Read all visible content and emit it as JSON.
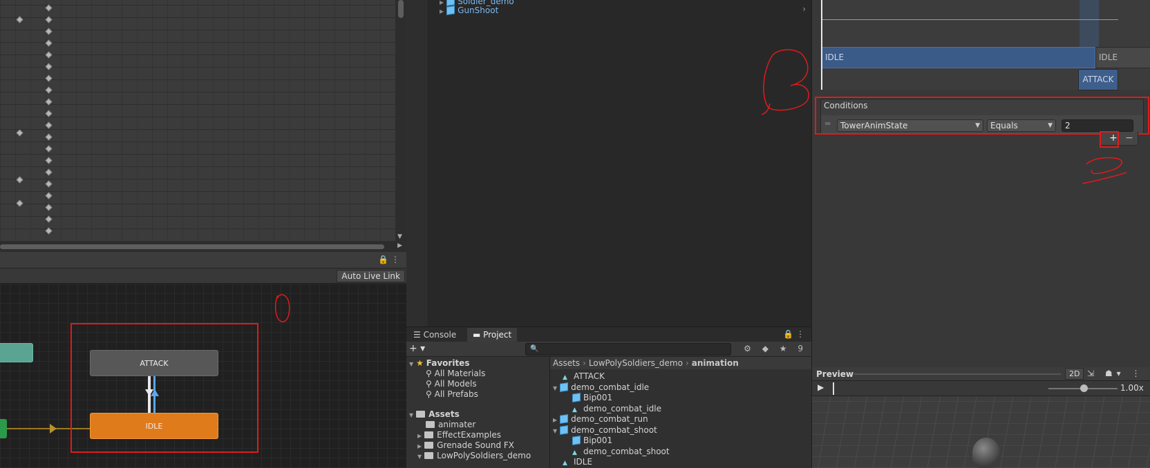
{
  "animator": {
    "auto_live_link": "Auto Live Link",
    "states": {
      "attack": "ATTACK",
      "idle": "IDLE"
    }
  },
  "hierarchy": {
    "items": [
      "Soldier_demo",
      "GunShoot"
    ]
  },
  "project": {
    "tabs": [
      "Console",
      "Project"
    ],
    "hidden_count": "9",
    "tree": {
      "favorites_label": "Favorites",
      "favorites": [
        "All Materials",
        "All Models",
        "All Prefabs"
      ],
      "assets_label": "Assets",
      "assets": [
        "animater",
        "EffectExamples",
        "Grenade Sound FX",
        "LowPolySoldiers_demo"
      ]
    },
    "breadcrumb": [
      "Assets",
      "LowPolySoldiers_demo",
      "animation"
    ],
    "files": [
      {
        "name": "ATTACK",
        "kind": "clip",
        "indent": 0
      },
      {
        "name": "demo_combat_idle",
        "kind": "model",
        "indent": 0,
        "expanded": true
      },
      {
        "name": "Bip001",
        "kind": "model",
        "indent": 1
      },
      {
        "name": "demo_combat_idle",
        "kind": "clip",
        "indent": 1
      },
      {
        "name": "demo_combat_run",
        "kind": "model",
        "indent": 0,
        "expanded": false
      },
      {
        "name": "demo_combat_shoot",
        "kind": "model",
        "indent": 0,
        "expanded": true
      },
      {
        "name": "Bip001",
        "kind": "model",
        "indent": 1
      },
      {
        "name": "demo_combat_shoot",
        "kind": "clip",
        "indent": 1
      },
      {
        "name": "IDLE",
        "kind": "clip",
        "indent": 0
      }
    ]
  },
  "inspector": {
    "timeline": {
      "idle_main": "IDLE",
      "idle_side": "IDLE",
      "attack": "ATTACK"
    },
    "conditions": {
      "title": "Conditions",
      "parameter": "TowerAnimState",
      "operator": "Equals",
      "value": "2"
    },
    "add_label": "+",
    "remove_label": "−"
  },
  "preview": {
    "title": "Preview",
    "mode_2d": "2D",
    "speed": "1.00x",
    "speed_fraction": 0.47
  },
  "colors": {
    "accent_blue": "#3a5a88",
    "idle_state": "#e07b1c",
    "annotation_red": "#e01b1b"
  }
}
